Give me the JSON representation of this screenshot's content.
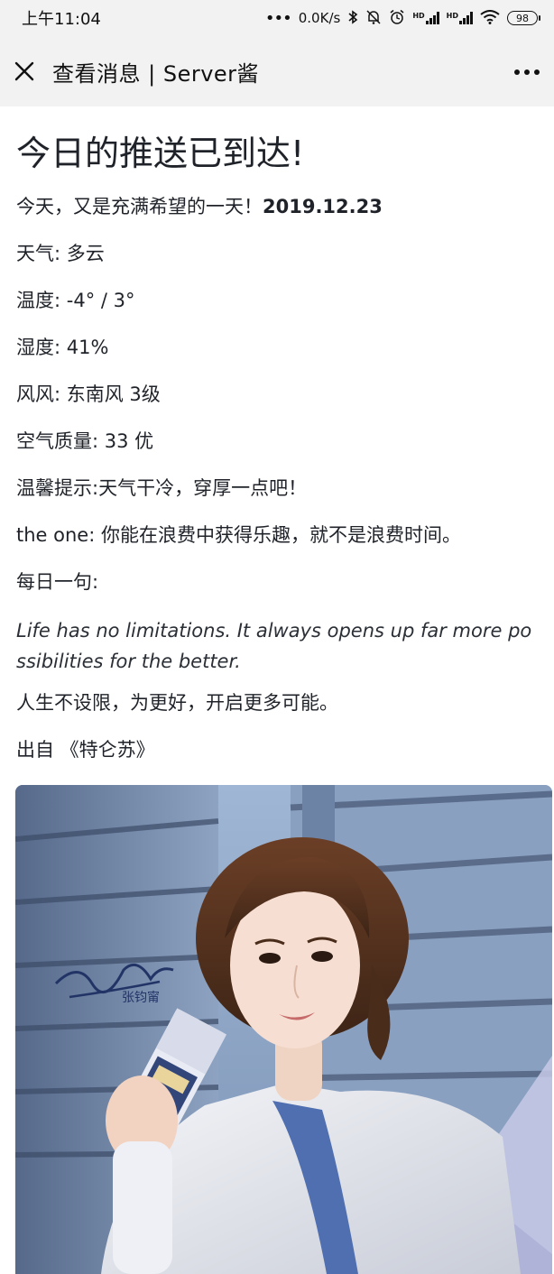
{
  "status_bar": {
    "time": "上午11:04",
    "network_speed": "0.0K/s",
    "signal_1_label": "HD",
    "signal_2_label": "HD",
    "battery": "98"
  },
  "navbar": {
    "title": "查看消息 | Server酱",
    "close_icon": "close-icon",
    "more_icon": "more-icon"
  },
  "message": {
    "headline": "今日的推送已到达!",
    "greeting": "今天，又是充满希望的一天！",
    "date": "2019.12.23",
    "weather": "天气: 多云",
    "temperature": "温度: -4° / 3°",
    "humidity": "湿度: 41%",
    "wind": "风风: 东南风 3级",
    "air_quality": "空气质量: 33 优",
    "tip": "温馨提示:天气干冷，穿厚一点吧！",
    "the_one": "the one: 你能在浪费中获得乐趣，就不是浪费时间。",
    "daily_label": "每日一句:",
    "quote_en": "Life has no limitations. It always opens up far more possibilities for the better.",
    "quote_cn": "人生不设限，为更好，开启更多可能。",
    "source": "出自 《特仑苏》"
  },
  "ad_image": {
    "signature_name": "张钧甯"
  }
}
